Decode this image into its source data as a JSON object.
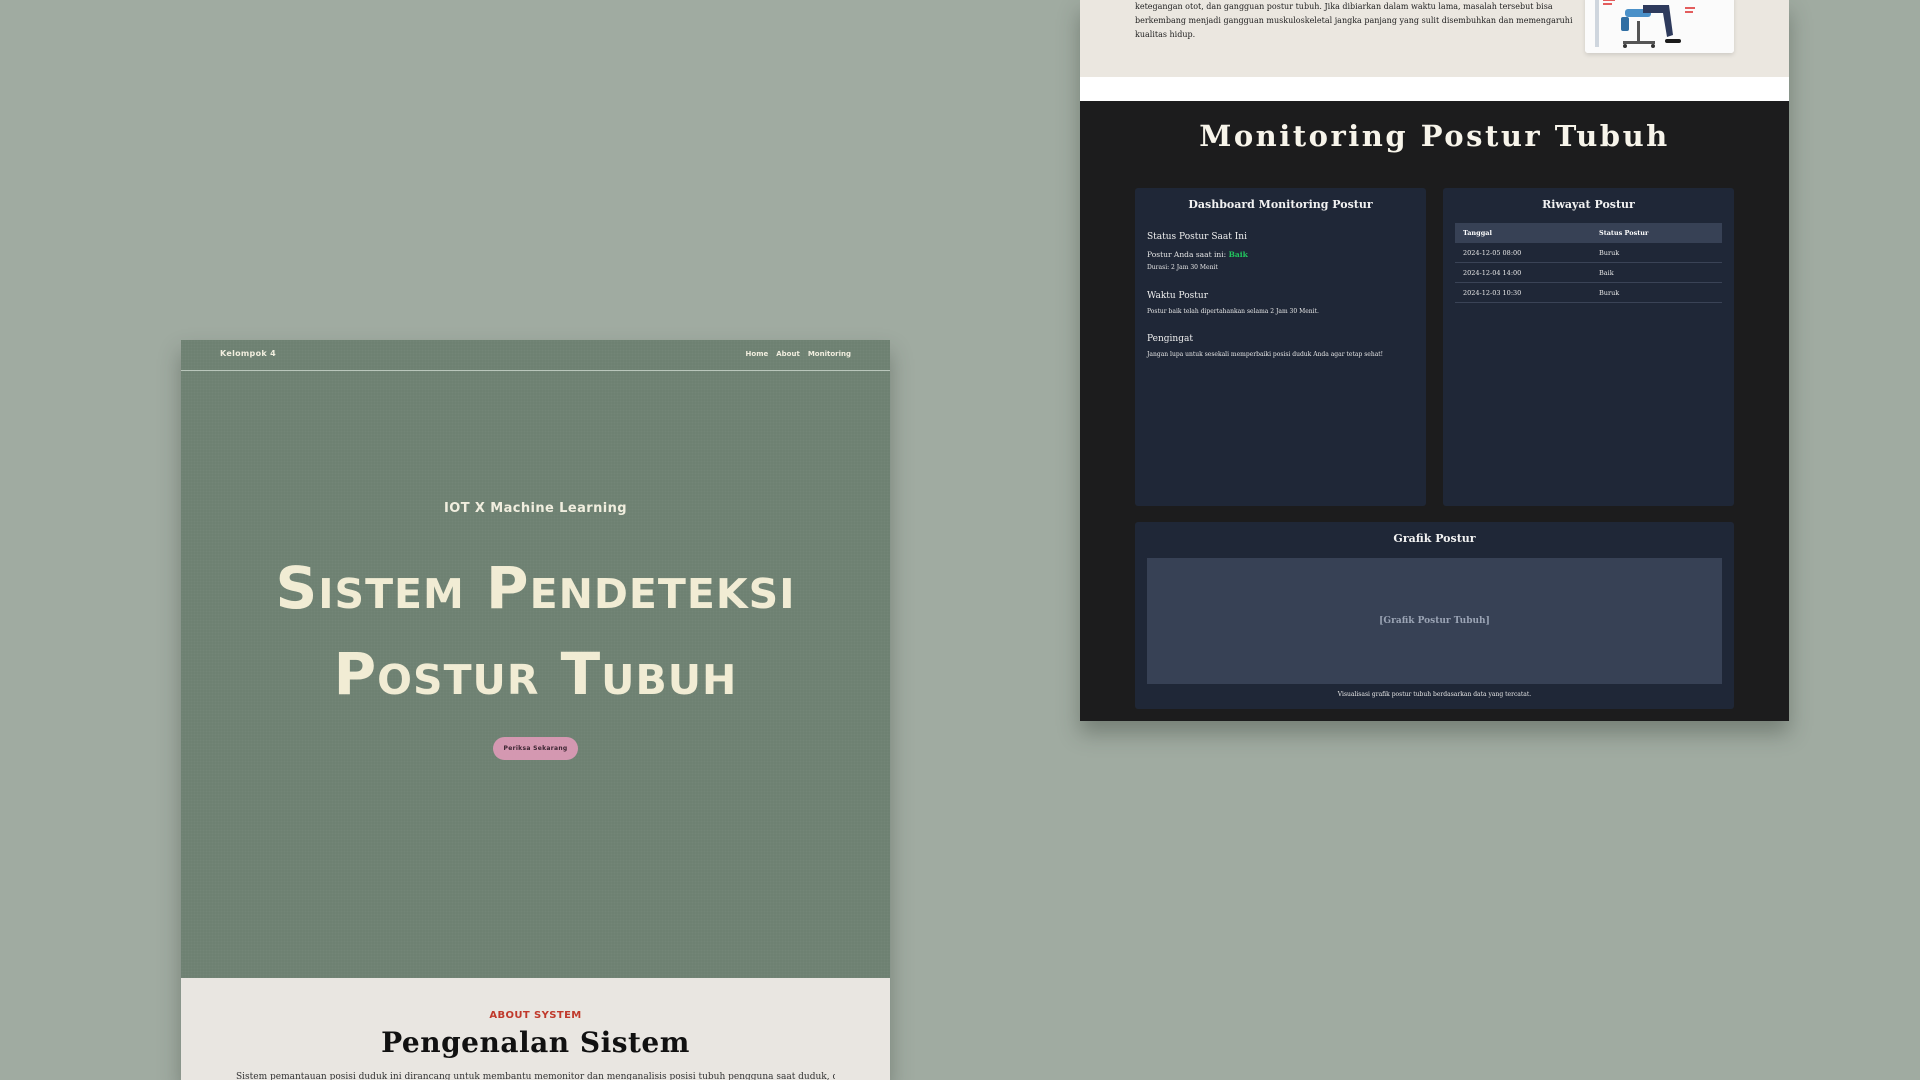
{
  "landing": {
    "nav": {
      "brand": "Kelompok 4",
      "links": [
        "Home",
        "About",
        "Monitoring"
      ]
    },
    "hero": {
      "kicker": "IOT X Machine Learning",
      "title_line1": "Sistem Pendeteksi",
      "title_line2": "Postur Tubuh",
      "cta": "Periksa Sekarang"
    },
    "about": {
      "kicker": "ABOUT SYSTEM",
      "title": "Pengenalan Sistem",
      "text": "Sistem pemantauan posisi duduk ini dirancang untuk membantu memonitor dan menganalisis posisi tubuh pengguna saat duduk, dengan"
    }
  },
  "monitoring_page": {
    "article": {
      "lines": [
        "ketegangan otot, dan gangguan postur tubuh. Jika dibiarkan dalam waktu lama, masalah tersebut bisa",
        "berkembang menjadi gangguan muskuloskeletal jangka panjang yang sulit disembuhkan dan memengaruhi",
        "kualitas hidup."
      ]
    },
    "title": "Monitoring Postur Tubuh",
    "dashboard": {
      "title": "Dashboard Monitoring Postur",
      "status_heading": "Status Postur Saat Ini",
      "status_prefix": "Postur Anda saat ini:",
      "status_value": "Baik",
      "duration": "Durasi: 2 Jam 30 Menit",
      "time_heading": "Waktu Postur",
      "time_text": "Postur baik telah dipertahankan selama 2 Jam 30 Menit.",
      "reminder_heading": "Pengingat",
      "reminder_text": "Jangan lupa untuk sesekali memperbaiki posisi duduk Anda agar tetap sehat!"
    },
    "history": {
      "title": "Riwayat Postur",
      "columns": [
        "Tanggal",
        "Status Postur"
      ],
      "rows": [
        [
          "2024-12-05 08:00",
          "Buruk"
        ],
        [
          "2024-12-04 14:00",
          "Baik"
        ],
        [
          "2024-12-03 10:30",
          "Buruk"
        ]
      ]
    },
    "chart": {
      "title": "Grafik Postur",
      "placeholder": "[Grafik Postur Tubuh]",
      "caption": "Visualisasi grafik postur tubuh berdasarkan data yang tercatat."
    }
  },
  "colors": {
    "background": "#a0aba1",
    "hero": "#6e8172",
    "cta": "#d498b1",
    "accent_red": "#c0392b",
    "dark_panel": "#1c1c1d",
    "card": "#1f2737",
    "good_status": "#22c55e"
  }
}
